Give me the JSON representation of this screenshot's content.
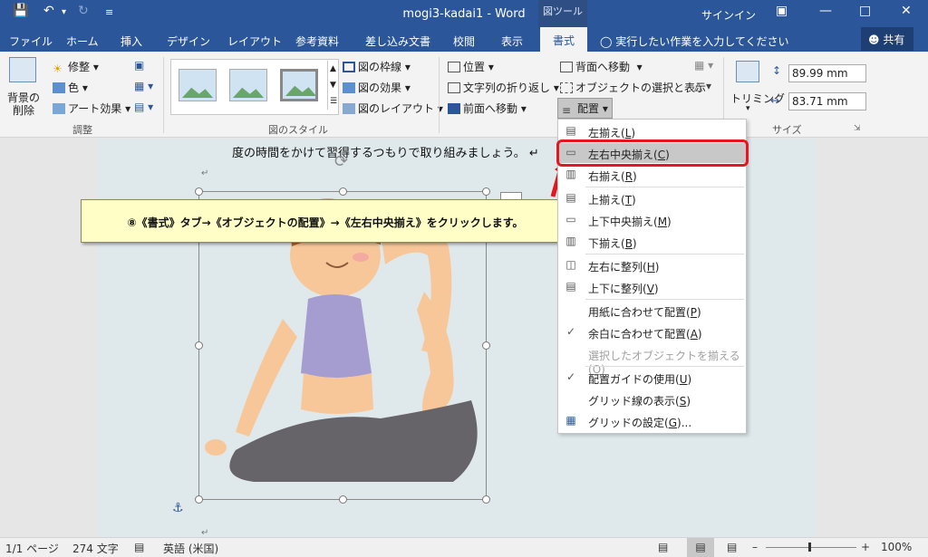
{
  "window": {
    "title": "mogi3-kadai1  -  Word",
    "context_tool": "図ツール",
    "signin": "サインイン"
  },
  "tabs": [
    "ファイル",
    "ホーム",
    "挿入",
    "デザイン",
    "レイアウト",
    "参考資料",
    "差し込み文書",
    "校閲",
    "表示"
  ],
  "active_tab": "書式",
  "tellme": "実行したい作業を入力してください",
  "share": "共有",
  "ribbon": {
    "remove_bg": [
      "背景の",
      "削除"
    ],
    "adjust": [
      "修整",
      "色",
      "アート効果"
    ],
    "adjust_group": "調整",
    "styles_group": "図のスタイル",
    "picture_opts": [
      "図の枠線",
      "図の効果",
      "図のレイアウト"
    ],
    "arrange_left": [
      "位置",
      "文字列の折り返し",
      "前面へ移動"
    ],
    "arrange_right": [
      "背面へ移動",
      "オブジェクトの選択と表示",
      "配置"
    ],
    "crop": "トリミング",
    "height": "89.99 mm",
    "width": "83.71 mm",
    "size_group": "サイズ"
  },
  "document": {
    "text": "度の時間をかけて習得するつもりで取り組みましょう。",
    "para_mark": "↵"
  },
  "callout": "⑧《書式》タブ→《オブジェクトの配置》→《左右中央揃え》をクリックします。",
  "menu": {
    "items": [
      {
        "label": "左揃え(",
        "key": "L"
      },
      {
        "label": "左右中央揃え(",
        "key": "C"
      },
      {
        "label": "右揃え(",
        "key": "R"
      },
      {
        "label": "上揃え(",
        "key": "T"
      },
      {
        "label": "上下中央揃え(",
        "key": "M"
      },
      {
        "label": "下揃え(",
        "key": "B"
      },
      {
        "label": "左右に整列(",
        "key": "H"
      },
      {
        "label": "上下に整列(",
        "key": "V"
      },
      {
        "label": "用紙に合わせて配置(",
        "key": "P"
      },
      {
        "label": "余白に合わせて配置(",
        "key": "A"
      },
      {
        "label": "選択したオブジェクトを揃える(",
        "key": "O"
      },
      {
        "label": "配置ガイドの使用(",
        "key": "U"
      },
      {
        "label": "グリッド線の表示(",
        "key": "S"
      },
      {
        "label": "グリッドの設定(",
        "key": "G"
      }
    ],
    "close_paren": ")",
    "ellipsis": "..."
  },
  "statusbar": {
    "page": "1/1 ページ",
    "words": "274 文字",
    "lang": "英語 (米国)",
    "zoom": "100%"
  },
  "colors": {
    "title_blue": "#2b579a",
    "highlight_red": "#e8141e",
    "callout_bg": "#fffec6"
  }
}
